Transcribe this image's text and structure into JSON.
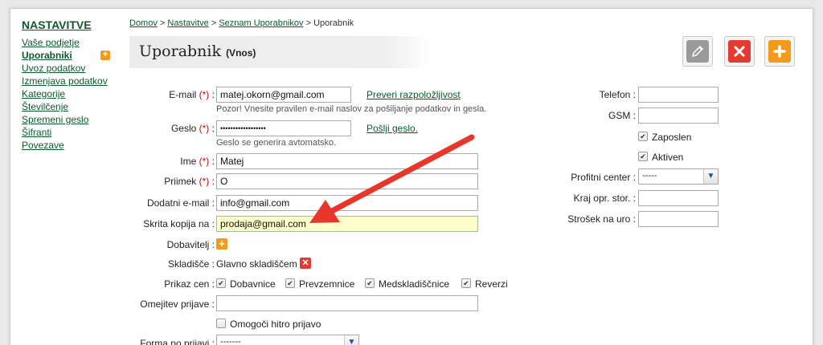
{
  "sidebar": {
    "title": "NASTAVITVE",
    "items": [
      {
        "label": "Vaše podjetje"
      },
      {
        "label": "Uporabniki"
      },
      {
        "label": "Uvoz podatkov"
      },
      {
        "label": "Izmenjava podatkov"
      },
      {
        "label": "Kategorije"
      },
      {
        "label": "Številčenje"
      },
      {
        "label": "Spremeni geslo"
      },
      {
        "label": "Šifranti"
      },
      {
        "label": "Povezave"
      }
    ]
  },
  "breadcrumb": {
    "home": "Domov",
    "sep": ">",
    "settings": "Nastavitve",
    "list": "Seznam Uporabnikov",
    "current": "Uporabnik"
  },
  "header": {
    "title": "Uporabnik",
    "subtitle": "(Vnos)"
  },
  "icons": {
    "edit": "pencil-icon",
    "cancel": "close-icon",
    "add": "plus-icon"
  },
  "colors": {
    "link_green": "#0a5a2c",
    "required_red": "#d40000",
    "highlight_yellow": "#ffffcc",
    "arrow_red": "#e8362b",
    "plus_orange": "#f39a1d"
  },
  "form": {
    "email": {
      "label": "E-mail",
      "req": "(*)",
      "colon": ":",
      "value": "matej.okorn@gmail.com",
      "link": "Preveri razpoložljivost",
      "hint": "Pozor! Vnesite pravilen e-mail naslov za pošiljanje podatkov in gesla."
    },
    "password": {
      "label": "Geslo",
      "req": "(*)",
      "colon": ":",
      "value": "••••••••••••••••••",
      "link": "Pošlji geslo.",
      "hint": "Geslo se generira avtomatsko."
    },
    "first_name": {
      "label": "Ime",
      "req": "(*)",
      "colon": ":",
      "value": "Matej"
    },
    "last_name": {
      "label": "Priimek",
      "req": "(*)",
      "colon": ":",
      "value": "O"
    },
    "extra_email": {
      "label": "Dodatni e-mail :",
      "value": "info@gmail.com"
    },
    "bcc": {
      "label": "Skrita kopija na :",
      "value": "prodaja@gmail.com"
    },
    "supplier": {
      "label": "Dobavitelj :"
    },
    "warehouse": {
      "label": "Skladišče :",
      "value": "Glavno skladiščem"
    },
    "prices": {
      "label": "Prikaz cen :",
      "options": [
        {
          "label": "Dobavnice",
          "checked": true
        },
        {
          "label": "Prevzemnice",
          "checked": true
        },
        {
          "label": "Medskladiščnice",
          "checked": true
        },
        {
          "label": "Reverzi",
          "checked": true
        }
      ]
    },
    "login_limit": {
      "label": "Omejitev prijave :",
      "value": ""
    },
    "quick_login": {
      "label": "Omogoči hitro prijavo",
      "checked": false
    },
    "login_form": {
      "label": "Forma po prijavi :",
      "value": "-------"
    }
  },
  "right_form": {
    "phone": {
      "label": "Telefon :",
      "value": ""
    },
    "gsm": {
      "label": "GSM :",
      "value": ""
    },
    "employed": {
      "label": "Zaposlen",
      "checked": true
    },
    "active": {
      "label": "Aktiven",
      "checked": true
    },
    "profit_center": {
      "label": "Profitni center :",
      "value": "-----"
    },
    "cost_place": {
      "label": "Kraj opr. stor. :",
      "value": ""
    },
    "hourly_cost": {
      "label": "Strošek na uro :",
      "value": ""
    }
  }
}
